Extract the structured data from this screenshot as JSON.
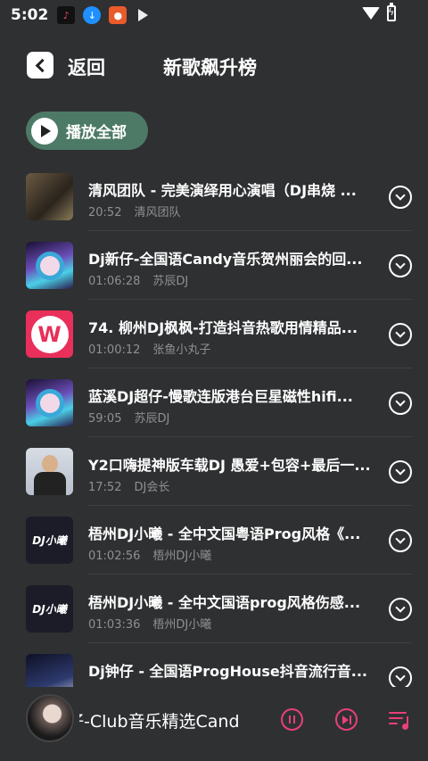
{
  "status_bar": {
    "time": "5:02",
    "icons": [
      "app-icon",
      "download-icon",
      "app-icon",
      "play-icon",
      "wifi-icon",
      "battery-charging-icon"
    ]
  },
  "header": {
    "back_label": "返回",
    "title": "新歌飙升榜"
  },
  "play_all": {
    "label": "播放全部"
  },
  "songs": [
    {
      "title": "清风团队 - 完美演绎用心演唱（DJ串烧 ...",
      "duration": "20:52",
      "artist": "清风团队",
      "cover": "photo"
    },
    {
      "title": "Dj新仔-全国语Candy音乐贺州丽会的回...",
      "duration": "01:06:28",
      "artist": "苏辰DJ",
      "cover": "anime"
    },
    {
      "title": "74. 柳州DJ枫枫-打造抖音热歌用情精品...",
      "duration": "01:00:12",
      "artist": "张鱼小丸子",
      "cover": "logo"
    },
    {
      "title": "蓝溪DJ超仔-慢歌连版港台巨星磁性hifi...",
      "duration": "59:05",
      "artist": "苏辰DJ",
      "cover": "anime"
    },
    {
      "title": "Y2口嗨提神版车载DJ 愚爱+包容+最后一...",
      "duration": "17:52",
      "artist": "DJ会长",
      "cover": "man"
    },
    {
      "title": "梧州DJ小曦 - 全中文国粤语Prog风格《...",
      "duration": "01:02:56",
      "artist": "梧州DJ小曦",
      "cover": "dj"
    },
    {
      "title": "梧州DJ小曦 - 全中文国语prog风格伤感...",
      "duration": "01:03:36",
      "artist": "梧州DJ小曦",
      "cover": "dj"
    },
    {
      "title": "Dj钟仔 - 全国语ProgHouse抖音流行音...",
      "duration": "",
      "artist": "",
      "cover": "cat"
    }
  ],
  "cover_text": {
    "dj": "DJ小曦"
  },
  "mini_player": {
    "title": "仔-Club音乐精选Cand"
  },
  "colors": {
    "background": "#2f3032",
    "play_all_bg": "#4d7a66",
    "accent": "#e8407a",
    "secondary_text": "#8e9093"
  }
}
